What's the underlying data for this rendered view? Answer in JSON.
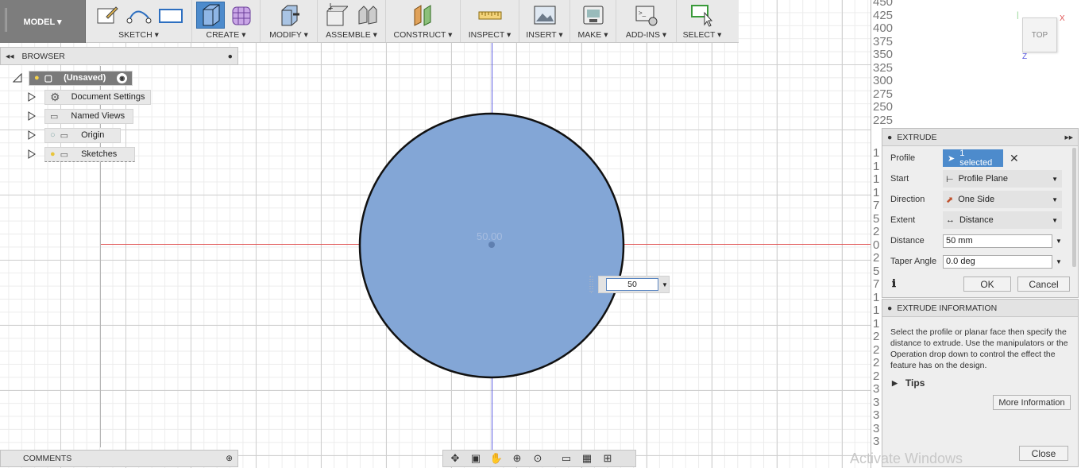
{
  "toolbar": {
    "model_label": "MODEL ▾",
    "groups": {
      "sketch": "SKETCH ▾",
      "create": "CREATE ▾",
      "modify": "MODIFY ▾",
      "assemble": "ASSEMBLE ▾",
      "construct": "CONSTRUCT ▾",
      "inspect": "INSPECT ▾",
      "insert": "INSERT ▾",
      "make": "MAKE ▾",
      "addins": "ADD-INS ▾",
      "select": "SELECT ▾"
    }
  },
  "browser": {
    "title": "BROWSER",
    "root": "(Unsaved)",
    "items": [
      "Document Settings",
      "Named Views",
      "Origin",
      "Sketches"
    ]
  },
  "comments": {
    "title": "COMMENTS"
  },
  "canvas": {
    "ghost_dimension": "50.00",
    "dimension_input": "50"
  },
  "ruler": {
    "labels": [
      "450",
      "425",
      "400",
      "375",
      "350",
      "325",
      "300",
      "275",
      "250",
      "225"
    ],
    "side_labels": [
      "1",
      "1",
      "1",
      "1",
      "7",
      "5",
      "2",
      "0",
      "2",
      "5",
      "7",
      "1",
      "1",
      "1",
      "2",
      "2",
      "2",
      "2",
      "3",
      "3",
      "3",
      "3",
      "3"
    ]
  },
  "viewcube": {
    "face": "TOP",
    "axis_x": "X",
    "axis_z": "Z"
  },
  "extrude": {
    "title": "EXTRUDE",
    "profile_label": "Profile",
    "profile_value": "1 selected",
    "start_label": "Start",
    "start_value": "Profile Plane",
    "direction_label": "Direction",
    "direction_value": "One Side",
    "extent_label": "Extent",
    "extent_value": "Distance",
    "distance_label": "Distance",
    "distance_value": "50 mm",
    "taper_label": "Taper Angle",
    "taper_value": "0.0 deg",
    "ok": "OK",
    "cancel": "Cancel"
  },
  "extrude_info": {
    "title": "EXTRUDE INFORMATION",
    "text": "Select the profile or planar face then specify the distance to extrude. Use the manipulators or the Operation drop down to control the effect the feature has on the design.",
    "tips": "Tips",
    "more_info": "More Information",
    "close": "Close"
  },
  "watermark": "Activate Windows",
  "colors": {
    "profile_fill": "#83a6d6",
    "accent": "#4d8bcc"
  }
}
